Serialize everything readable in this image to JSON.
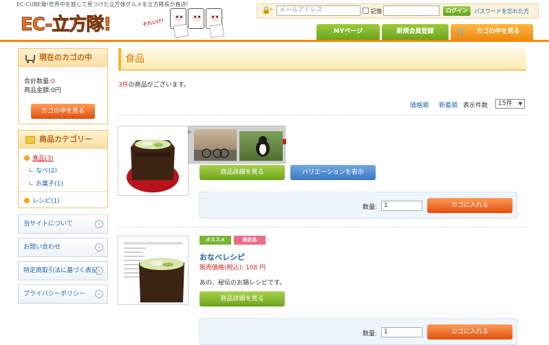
{
  "header": {
    "tagline": "EC-CUBE発!世界中を旅して見つけた立方体グルメを立方隊長が直送!",
    "logo_text": "EC-立方隊!",
    "logo_badge": "それいけ!",
    "email_placeholder": "メールアドレス",
    "remember_label": "記憶",
    "login_button": "ログイン",
    "forgot_password_link": "パスワードを忘れた方",
    "nav": [
      "MYページ",
      "新規会員登録",
      "カゴの中を見る"
    ]
  },
  "sidebar": {
    "cart": {
      "title": "現在のカゴの中",
      "quantity_label": "合計数量:",
      "quantity_value": "0",
      "amount_label": "商品金額:",
      "amount_value": "0円",
      "view_button": "カゴの中を見る"
    },
    "categories": {
      "title": "商品カテゴリー",
      "items": [
        {
          "label": "食品(3)"
        },
        {
          "label": "なべ(2)"
        },
        {
          "label": "お菓子(1)"
        },
        {
          "label": "レシピ(1)"
        }
      ]
    },
    "links": [
      "当サイトについて",
      "お問い合わせ",
      "特定商取引法に基づく表記",
      "プライバシーポリシー"
    ]
  },
  "main": {
    "page_title": "食品",
    "result_count": "3件",
    "result_suffix": "の商品がございます。",
    "sort_price": "価格順",
    "sort_new": "新着順",
    "per_page_label": "表示件数",
    "per_page_value": "15件",
    "products": [
      {
        "detail_button": "商品詳細を見る",
        "variation_button": "バリエーションを表示",
        "quantity_label": "数量:",
        "quantity_value": "1",
        "cart_button": "カゴに入れる"
      },
      {
        "badges": [
          "オススメ",
          "限定品"
        ],
        "name": "おなべレシピ",
        "price_label": "販売価格(税込):",
        "price_value": "108 円",
        "description": "あの、秘伝のお鍋レシピです。",
        "detail_button": "商品詳細を見る",
        "quantity_label": "数量:",
        "quantity_value": "1",
        "cart_button": "カゴに入れる"
      }
    ]
  },
  "colors": {
    "accent_orange": "#f08a10",
    "accent_green": "#7cb32a",
    "link_blue": "#1a64b4",
    "price_red": "#d32020"
  }
}
